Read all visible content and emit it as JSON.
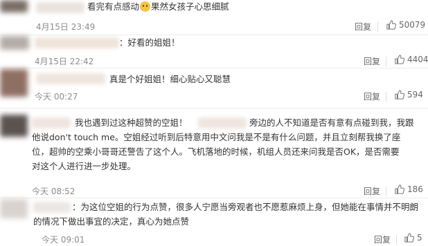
{
  "comments": [
    {
      "text": "看完有点感动",
      "text_after": "果然女孩子心思细腻",
      "time": "4月15日 23:49",
      "reply_label": "回复",
      "like_count": "50079"
    },
    {
      "text": "：好看的姐姐！",
      "time": "4月15日 22:42",
      "reply_label": "回复",
      "like_count": "4404"
    },
    {
      "text": "真是个好姐姐！细心贴心又聪慧",
      "time": "今天 00:27",
      "reply_label": "回复",
      "like_count": "594"
    },
    {
      "lines": [
        "我也遇到过这种超赞的空姐！",
        "旁边的人不知道是否有意有点碰到我，我跟",
        "他说don't touch me。空姐经过听到后特意用中文问我是不是有什么问题，并且立刻帮我换了座",
        "位，超帅的空乘小哥哥还警告了这个人。飞机落地的时候，机组人员还来问我是否OK，是否需要",
        "对这个人进行进一步处理。"
      ],
      "time": "今天 08:52",
      "reply_label": "回复",
      "like_count": "186"
    },
    {
      "lines": [
        "：为这位空姐的行为点赞，很多人宁愿当旁观者也不愿惹麻烦上身，但她能在事情并不明朗",
        "的情况下做出事宜的决定，真心为她点赞"
      ],
      "time": "今天 09:01",
      "reply_label": "回复",
      "like_count": "5"
    }
  ],
  "icons": {
    "like": "thumbs-up-icon",
    "emoji": "sad-face-emoji-icon"
  },
  "colors": {
    "text": "#333333",
    "meta": "#8c8c8c",
    "divider": "#ececec"
  }
}
